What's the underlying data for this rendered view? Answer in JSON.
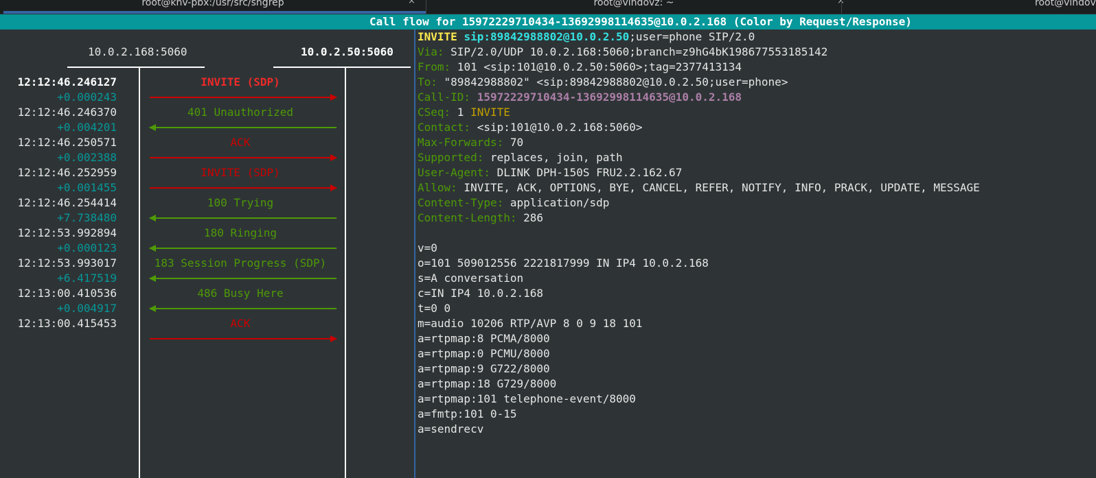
{
  "tabs": [
    {
      "label": "root@knv-pbx:/usr/src/sngrep",
      "close": "×"
    },
    {
      "label": "root@vindovz: ~",
      "close": "×"
    },
    {
      "label": "root@vindovz"
    }
  ],
  "title": "Call flow for 15972229710434-13692998114635@10.0.2.168 (Color by Request/Response)",
  "hosts": {
    "left": "10.0.2.168:5060",
    "right": "10.0.2.50:5060"
  },
  "messages": [
    {
      "time": "12:12:46.246127",
      "delta": "+0.000243",
      "label": "INVITE (SDP)",
      "kind": "request",
      "dir": "right",
      "selected": true
    },
    {
      "time": "12:12:46.246370",
      "delta": "+0.004201",
      "label": "401 Unauthorized",
      "kind": "response",
      "dir": "left"
    },
    {
      "time": "12:12:46.250571",
      "delta": "+0.002388",
      "label": "ACK",
      "kind": "request",
      "dir": "right"
    },
    {
      "time": "12:12:46.252959",
      "delta": "+0.001455",
      "label": "INVITE (SDP)",
      "kind": "request",
      "dir": "right"
    },
    {
      "time": "12:12:46.254414",
      "delta": "+7.738480",
      "label": "100 Trying",
      "kind": "response",
      "dir": "left"
    },
    {
      "time": "12:12:53.992894",
      "delta": "+0.000123",
      "label": "180 Ringing",
      "kind": "response",
      "dir": "left"
    },
    {
      "time": "12:12:53.993017",
      "delta": "+6.417519",
      "label": "183 Session Progress (SDP)",
      "kind": "response",
      "dir": "left"
    },
    {
      "time": "12:13:00.410536",
      "delta": "+0.004917",
      "label": "486 Busy Here",
      "kind": "response",
      "dir": "left"
    },
    {
      "time": "12:13:00.415453",
      "delta": "",
      "label": "ACK",
      "kind": "request",
      "dir": "right"
    }
  ],
  "raw": {
    "request_line": {
      "method": "INVITE",
      "uri": "sip:89842988802@10.0.2.50",
      "rest": ";user=phone SIP/2.0"
    },
    "headers": [
      {
        "name": "Via:",
        "value": " SIP/2.0/UDP 10.0.2.168:5060;branch=z9hG4bK198677553185142"
      },
      {
        "name": "From:",
        "value": " 101 <sip:101@10.0.2.50:5060>;tag=2377413134"
      },
      {
        "name": "To:",
        "value": " \"89842988802\" <sip:89842988802@10.0.2.50;user=phone>"
      },
      {
        "name": "Call-ID:",
        "value": " 15972229710434-13692998114635@10.0.2.168",
        "style": "callid"
      },
      {
        "name": "CSeq:",
        "value": " 1 ",
        "method": "INVITE"
      },
      {
        "name": "Contact:",
        "value": " <sip:101@10.0.2.168:5060>"
      },
      {
        "name": "Max-Forwards:",
        "value": " 70"
      },
      {
        "name": "Supported:",
        "value": " replaces, join, path"
      },
      {
        "name": "User-Agent:",
        "value": " DLINK DPH-150S FRU2.2.162.67"
      },
      {
        "name": "Allow:",
        "value": " INVITE, ACK, OPTIONS, BYE, CANCEL, REFER, NOTIFY, INFO, PRACK, UPDATE, MESSAGE"
      },
      {
        "name": "Content-Type:",
        "value": " application/sdp"
      },
      {
        "name": "Content-Length:",
        "value": " 286"
      }
    ],
    "body": [
      "",
      "v=0",
      "o=101 509012556 2221817999 IN IP4 10.0.2.168",
      "s=A conversation",
      "c=IN IP4 10.0.2.168",
      "t=0 0",
      "m=audio 10206 RTP/AVP 8 0 9 18 101",
      "a=rtpmap:8 PCMA/8000",
      "a=rtpmap:0 PCMU/8000",
      "a=rtpmap:9 G722/8000",
      "a=rtpmap:18 G729/8000",
      "a=rtpmap:101 telephone-event/8000",
      "a=fmtp:101 0-15",
      "a=sendrecv"
    ]
  }
}
